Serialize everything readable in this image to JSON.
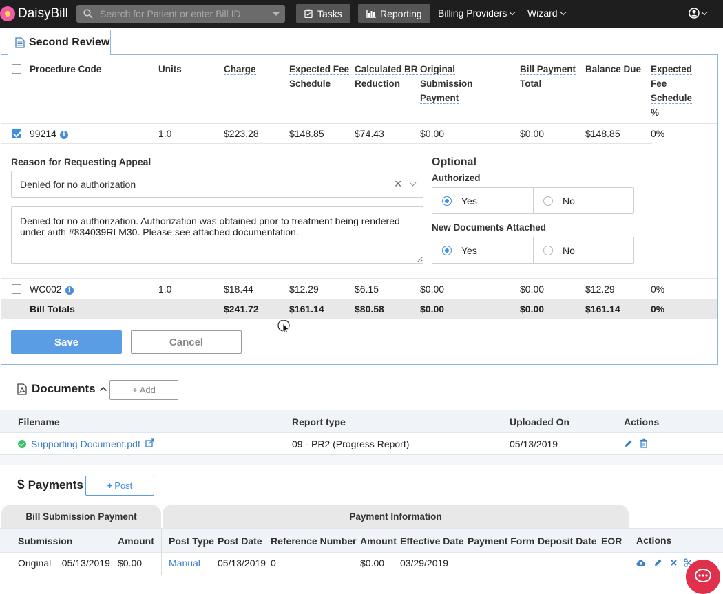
{
  "nav": {
    "brand": "DaisyBill",
    "search_placeholder": "Search for Patient or enter Bill ID",
    "tasks": "Tasks",
    "reporting": "Reporting",
    "billing_providers": "Billing Providers",
    "wizard": "Wizard"
  },
  "review": {
    "tab_title": "Second Review",
    "columns": [
      "Procedure Code",
      "Units",
      "Charge",
      "Expected Fee Schedule",
      "Calculated BR Reduction",
      "Original Submission Payment",
      "Bill Payment Total",
      "Balance Due",
      "Expected Fee Schedule %"
    ],
    "rows": [
      {
        "code": "99214",
        "units": "1.0",
        "charge": "$223.28",
        "expected": "$148.85",
        "br": "$74.43",
        "orig": "$0.00",
        "billpay": "$0.00",
        "balance": "$148.85",
        "pct": "0%",
        "checked": true
      },
      {
        "code": "WC002",
        "units": "1.0",
        "charge": "$18.44",
        "expected": "$12.29",
        "br": "$6.15",
        "orig": "$0.00",
        "billpay": "$0.00",
        "balance": "$12.29",
        "pct": "0%",
        "checked": false
      }
    ],
    "totals": {
      "label": "Bill Totals",
      "charge": "$241.72",
      "expected": "$161.14",
      "br": "$80.58",
      "orig": "$0.00",
      "billpay": "$0.00",
      "balance": "$161.14",
      "pct": "0%"
    },
    "reason_label": "Reason for Requesting Appeal",
    "reason_value": "Denied for no authorization",
    "reason_text": "Denied for no authorization. Authorization was obtained prior to treatment being rendered under auth #834039RLM30. Please see attached documentation.",
    "optional_label": "Optional",
    "authorized_label": "Authorized",
    "new_docs_label": "New Documents Attached",
    "yes": "Yes",
    "no": "No",
    "save": "Save",
    "cancel": "Cancel"
  },
  "documents": {
    "title": "Documents",
    "add": "Add",
    "columns": [
      "Filename",
      "Report type",
      "Uploaded On",
      "Actions"
    ],
    "rows": [
      {
        "filename": "Supporting Document.pdf",
        "report_type": "09 - PR2 (Progress Report)",
        "uploaded_on": "05/13/2019"
      }
    ]
  },
  "payments": {
    "title": "Payments",
    "post": "Post",
    "group_submission": "Bill Submission Payment",
    "group_payment": "Payment Information",
    "columns": [
      "Submission",
      "Amount",
      "Post Type",
      "Post Date",
      "Reference Number",
      "Amount",
      "Effective Date",
      "Payment Form",
      "Deposit Date",
      "EOR",
      "Actions"
    ],
    "rows": [
      {
        "submission": "Original – 05/13/2019",
        "amount": "$0.00",
        "post_type": "Manual",
        "post_date": "05/13/2019",
        "reference": "0",
        "pay_amount": "$0.00",
        "effective_date": "03/29/2019"
      }
    ]
  },
  "colors": {
    "accent": "#3d8fe3",
    "nav_bg": "#1e1e1e",
    "brand_pink": "#ef5da8",
    "danger": "#e0314c"
  }
}
